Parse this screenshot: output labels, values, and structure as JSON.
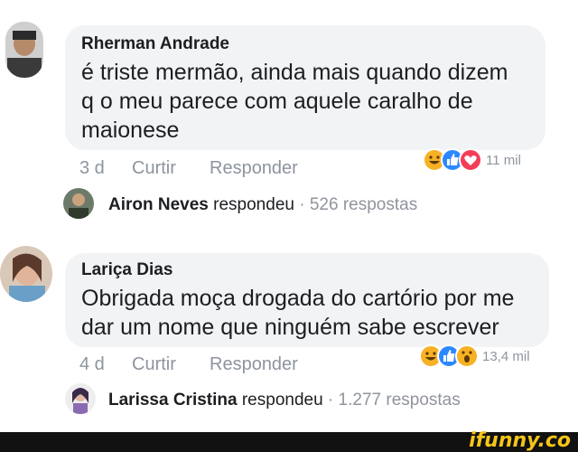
{
  "comments": [
    {
      "author": "Rherman Andrade",
      "lines": [
        "é triste mermão, ainda mais quando dizem",
        "q o meu parece com aquele caralho de",
        "maionese"
      ],
      "time": "3 d",
      "like_label": "Curtir",
      "reply_label": "Responder",
      "reaction_count": "11 mil",
      "reactions": [
        "haha-icon",
        "like-icon",
        "love-icon"
      ],
      "reply": {
        "name": "Airon Neves",
        "verb": "respondeu",
        "separator": "·",
        "count": "526 respostas"
      }
    },
    {
      "author": "Lariça Dias",
      "lines": [
        "Obrigada moça drogada do cartório por me",
        "dar um nome que ninguém sabe escrever"
      ],
      "time": "4 d",
      "like_label": "Curtir",
      "reply_label": "Responder",
      "reaction_count": "13,4 mil",
      "reactions": [
        "haha-icon",
        "like-icon",
        "wow-icon"
      ],
      "reply": {
        "name": "Larissa Cristina",
        "verb": "respondeu",
        "separator": "·",
        "count": "1.277 respostas"
      }
    }
  ],
  "watermark": "ifunny.co",
  "colors": {
    "like": "#2d88ff",
    "love": "#f33e58",
    "haha": "#f7b125",
    "footer": "#111111",
    "brand": "#f5c518"
  }
}
